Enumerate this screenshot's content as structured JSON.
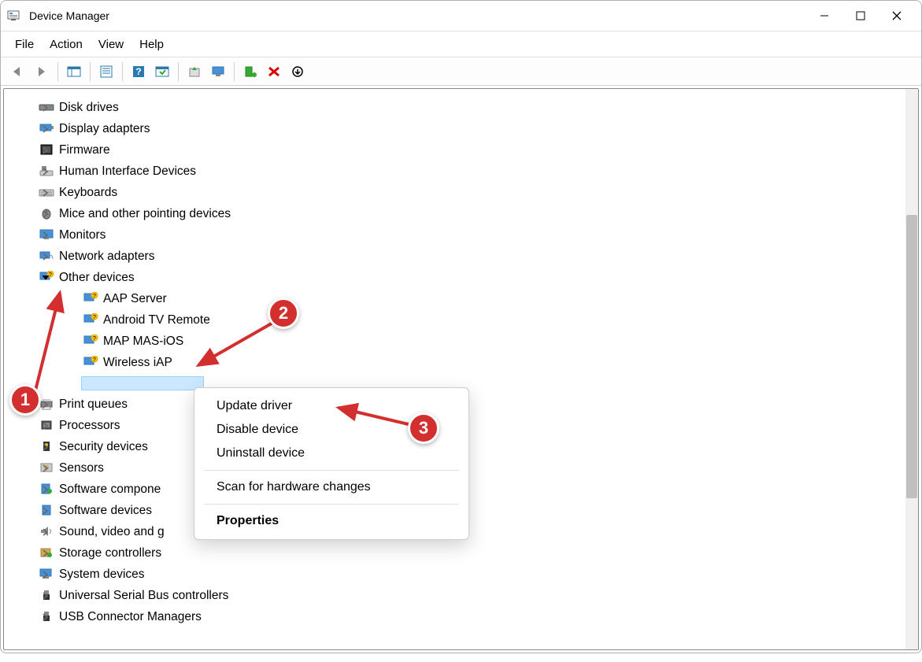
{
  "window": {
    "title": "Device Manager"
  },
  "menu": {
    "file": "File",
    "action": "Action",
    "view": "View",
    "help": "Help"
  },
  "tree": {
    "disk_drives": "Disk drives",
    "display_adapters": "Display adapters",
    "firmware": "Firmware",
    "hid": "Human Interface Devices",
    "keyboards": "Keyboards",
    "mice": "Mice and other pointing devices",
    "monitors": "Monitors",
    "network": "Network adapters",
    "other": "Other devices",
    "other_children": {
      "aap": "AAP Server",
      "android_tv": "Android TV Remote",
      "map_mas": "MAP MAS-iOS",
      "wireless_iap": "Wireless iAP"
    },
    "print_queues": "Print queues",
    "processors": "Processors",
    "security": "Security devices",
    "sensors": "Sensors",
    "soft_components": "Software compone",
    "soft_devices": "Software devices",
    "sound": "Sound, video and g",
    "storage": "Storage controllers",
    "system": "System devices",
    "usb_controllers": "Universal Serial Bus controllers",
    "usb_connector": "USB Connector Managers"
  },
  "context": {
    "update": "Update driver",
    "disable": "Disable device",
    "uninstall": "Uninstall device",
    "scan": "Scan for hardware changes",
    "properties": "Properties"
  },
  "annotations": {
    "1": "1",
    "2": "2",
    "3": "3"
  }
}
